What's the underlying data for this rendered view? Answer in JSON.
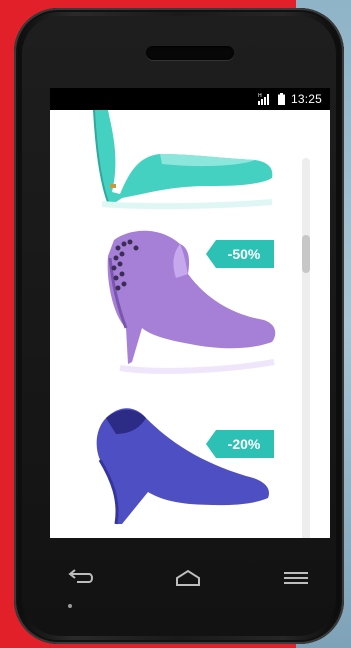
{
  "status_bar": {
    "time": "13:25",
    "signal_icon": "signal-icon",
    "battery_icon": "battery-icon"
  },
  "products": [
    {
      "color": "#45d1c2",
      "name": "teal-pump",
      "badge": ""
    },
    {
      "color": "#a67fd6",
      "name": "purple-bootie",
      "badge": "-50%"
    },
    {
      "color": "#4f4fc4",
      "name": "blue-pump",
      "badge": "-20%"
    }
  ],
  "badge_color": "#2cc1b4",
  "scroll": {
    "position": 0.22
  },
  "navigation": {
    "back_icon": "back-icon",
    "home_icon": "home-icon",
    "menu_icon": "menu-icon"
  }
}
